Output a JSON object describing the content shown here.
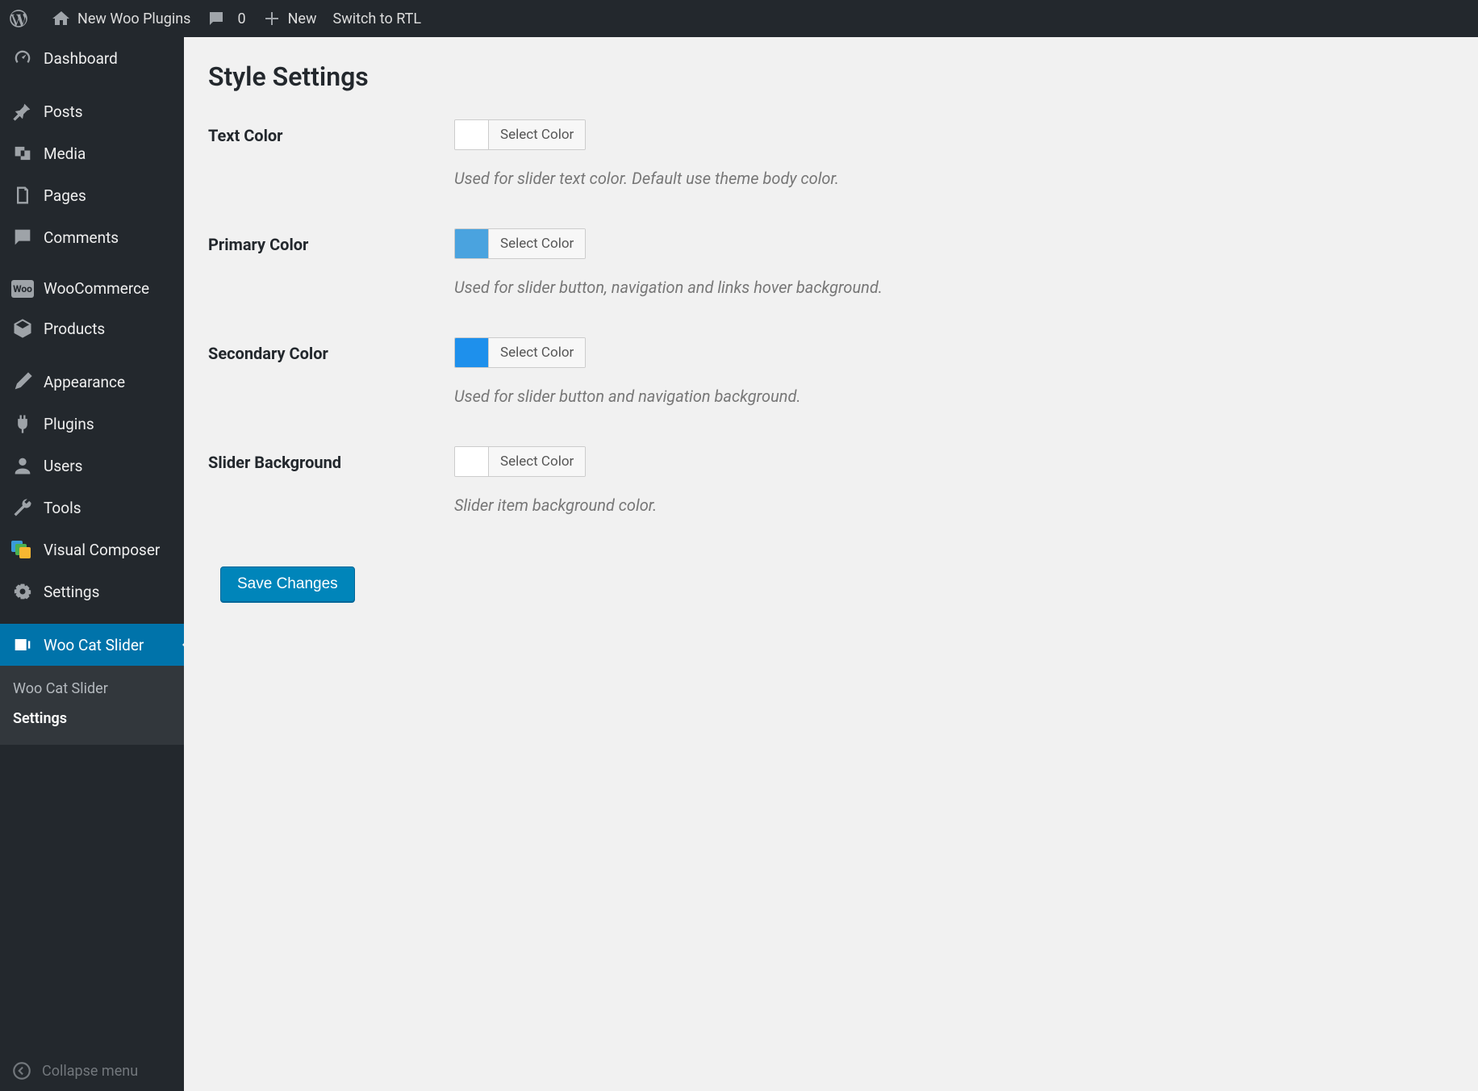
{
  "adminbar": {
    "site_title": "New Woo Plugins",
    "comment_count": "0",
    "new_label": "New",
    "rtl_label": "Switch to RTL"
  },
  "sidebar": {
    "items": [
      {
        "label": "Dashboard"
      },
      {
        "label": "Posts"
      },
      {
        "label": "Media"
      },
      {
        "label": "Pages"
      },
      {
        "label": "Comments"
      },
      {
        "label": "WooCommerce"
      },
      {
        "label": "Products"
      },
      {
        "label": "Appearance"
      },
      {
        "label": "Plugins"
      },
      {
        "label": "Users"
      },
      {
        "label": "Tools"
      },
      {
        "label": "Visual Composer"
      },
      {
        "label": "Settings"
      },
      {
        "label": "Woo Cat Slider"
      }
    ],
    "submenu": {
      "items": [
        {
          "label": "Woo Cat Slider"
        },
        {
          "label": "Settings"
        }
      ]
    },
    "collapse_label": "Collapse menu"
  },
  "page": {
    "title": "Style Settings",
    "fields": [
      {
        "label": "Text Color",
        "swatch": "#ffffff",
        "button": "Select Color",
        "description": "Used for slider text color. Default use theme body color."
      },
      {
        "label": "Primary Color",
        "swatch": "#4aa3df",
        "button": "Select Color",
        "description": "Used for slider button, navigation and links hover background."
      },
      {
        "label": "Secondary Color",
        "swatch": "#1e90ec",
        "button": "Select Color",
        "description": "Used for slider button and navigation background."
      },
      {
        "label": "Slider Background",
        "swatch": "#ffffff",
        "button": "Select Color",
        "description": "Slider item background color."
      }
    ],
    "save_button": "Save Changes"
  }
}
